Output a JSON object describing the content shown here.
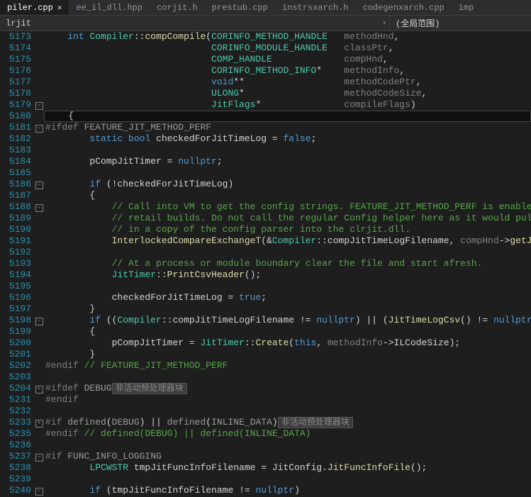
{
  "tabs": [
    {
      "label": "piler.cpp",
      "active": true,
      "close": "✕"
    },
    {
      "label": "ee_il_dll.hpp"
    },
    {
      "label": "corjit.h"
    },
    {
      "label": "prestub.cpp"
    },
    {
      "label": "instrsxarch.h"
    },
    {
      "label": "codegenxarch.cpp"
    },
    {
      "label": "imp"
    }
  ],
  "nav": {
    "scope_left": "lrjit",
    "scope_right": "(全局范围)",
    "arrow": "▾"
  },
  "gutter_start": 5173,
  "lines": [
    {
      "n": "5173",
      "ind": "    ",
      "tokens": [
        [
          "kw",
          "int"
        ],
        [
          "punct",
          " "
        ],
        [
          "type",
          "Compiler"
        ],
        [
          "punct",
          "::"
        ],
        [
          "func",
          "compCompile"
        ],
        [
          "punct",
          "("
        ],
        [
          "type",
          "CORINFO_METHOD_HANDLE"
        ],
        [
          "punct",
          "   "
        ],
        [
          "param",
          "methodHnd"
        ],
        [
          "punct",
          ","
        ]
      ]
    },
    {
      "n": "5174",
      "ind": "                              ",
      "tokens": [
        [
          "type",
          "CORINFO_MODULE_HANDLE"
        ],
        [
          "punct",
          "   "
        ],
        [
          "param",
          "classPtr"
        ],
        [
          "punct",
          ","
        ]
      ]
    },
    {
      "n": "5175",
      "ind": "                              ",
      "tokens": [
        [
          "type",
          "COMP_HANDLE"
        ],
        [
          "punct",
          "             "
        ],
        [
          "param",
          "compHnd"
        ],
        [
          "punct",
          ","
        ]
      ]
    },
    {
      "n": "5176",
      "ind": "                              ",
      "tokens": [
        [
          "type",
          "CORINFO_METHOD_INFO"
        ],
        [
          "punct",
          "*    "
        ],
        [
          "param",
          "methodInfo"
        ],
        [
          "punct",
          ","
        ]
      ]
    },
    {
      "n": "5177",
      "ind": "                              ",
      "tokens": [
        [
          "kw",
          "void"
        ],
        [
          "punct",
          "**                  "
        ],
        [
          "param",
          "methodCodePtr"
        ],
        [
          "punct",
          ","
        ]
      ]
    },
    {
      "n": "5178",
      "ind": "                              ",
      "tokens": [
        [
          "type",
          "ULONG"
        ],
        [
          "punct",
          "*                  "
        ],
        [
          "param",
          "methodCodeSize"
        ],
        [
          "punct",
          ","
        ]
      ]
    },
    {
      "n": "5179",
      "ind": "                              ",
      "fold": "-",
      "tokens": [
        [
          "type",
          "JitFlags"
        ],
        [
          "punct",
          "*               "
        ],
        [
          "param",
          "compileFlags"
        ],
        [
          "punct",
          ")"
        ]
      ]
    },
    {
      "n": "5180",
      "ind": "    ",
      "hl": true,
      "tokens": [
        [
          "punct",
          "{"
        ]
      ]
    },
    {
      "n": "5181",
      "ind": "",
      "fold": "-",
      "tokens": [
        [
          "macro-kw",
          "#ifdef"
        ],
        [
          "punct",
          " "
        ],
        [
          "macro",
          "FEATURE_JIT_METHOD_PERF"
        ]
      ]
    },
    {
      "n": "5182",
      "ind": "        ",
      "tokens": [
        [
          "kw",
          "static"
        ],
        [
          "punct",
          " "
        ],
        [
          "kw",
          "bool"
        ],
        [
          "punct",
          " checkedForJitTimeLog = "
        ],
        [
          "kw",
          "false"
        ],
        [
          "punct",
          ";"
        ]
      ]
    },
    {
      "n": "5183",
      "ind": "",
      "tokens": []
    },
    {
      "n": "5184",
      "ind": "        ",
      "tokens": [
        [
          "punct",
          "pCompJitTimer = "
        ],
        [
          "kw",
          "nullptr"
        ],
        [
          "punct",
          ";"
        ]
      ]
    },
    {
      "n": "5185",
      "ind": "",
      "tokens": []
    },
    {
      "n": "5186",
      "ind": "        ",
      "fold": "-",
      "tokens": [
        [
          "kw",
          "if"
        ],
        [
          "punct",
          " (!checkedForJitTimeLog)"
        ]
      ]
    },
    {
      "n": "5187",
      "ind": "        ",
      "tokens": [
        [
          "punct",
          "{"
        ]
      ]
    },
    {
      "n": "5188",
      "ind": "            ",
      "fold": "-",
      "tokens": [
        [
          "comment",
          "// Call into VM to get the config strings. FEATURE_JIT_METHOD_PERF is enabled for"
        ]
      ]
    },
    {
      "n": "5189",
      "ind": "            ",
      "tokens": [
        [
          "comment",
          "// retail builds. Do not call the regular Config helper here as it would pull"
        ]
      ]
    },
    {
      "n": "5190",
      "ind": "            ",
      "tokens": [
        [
          "comment",
          "// in a copy of the config parser into the clrjit.dll."
        ]
      ]
    },
    {
      "n": "5191",
      "ind": "            ",
      "tokens": [
        [
          "func",
          "InterlockedCompareExchangeT"
        ],
        [
          "punct",
          "(&"
        ],
        [
          "type",
          "Compiler"
        ],
        [
          "punct",
          "::compJitTimeLogFilename, "
        ],
        [
          "param",
          "compHnd"
        ],
        [
          "punct",
          "->"
        ],
        [
          "func",
          "getJitTimeLogFilen"
        ]
      ]
    },
    {
      "n": "5192",
      "ind": "",
      "tokens": []
    },
    {
      "n": "5193",
      "ind": "            ",
      "tokens": [
        [
          "comment",
          "// At a process or module boundary clear the file and start afresh."
        ]
      ]
    },
    {
      "n": "5194",
      "ind": "            ",
      "tokens": [
        [
          "type",
          "JitTimer"
        ],
        [
          "punct",
          "::"
        ],
        [
          "func",
          "PrintCsvHeader"
        ],
        [
          "punct",
          "();"
        ]
      ]
    },
    {
      "n": "5195",
      "ind": "",
      "tokens": []
    },
    {
      "n": "5196",
      "ind": "            ",
      "tokens": [
        [
          "punct",
          "checkedForJitTimeLog = "
        ],
        [
          "kw",
          "true"
        ],
        [
          "punct",
          ";"
        ]
      ]
    },
    {
      "n": "5197",
      "ind": "        ",
      "tokens": [
        [
          "punct",
          "}"
        ]
      ]
    },
    {
      "n": "5198",
      "ind": "        ",
      "fold": "-",
      "tokens": [
        [
          "kw",
          "if"
        ],
        [
          "punct",
          " (("
        ],
        [
          "type",
          "Compiler"
        ],
        [
          "punct",
          "::compJitTimeLogFilename != "
        ],
        [
          "kw",
          "nullptr"
        ],
        [
          "punct",
          ") || ("
        ],
        [
          "func",
          "JitTimeLogCsv"
        ],
        [
          "punct",
          "() != "
        ],
        [
          "kw",
          "nullptr"
        ],
        [
          "punct",
          "))"
        ]
      ]
    },
    {
      "n": "5199",
      "ind": "        ",
      "tokens": [
        [
          "punct",
          "{"
        ]
      ]
    },
    {
      "n": "5200",
      "ind": "            ",
      "tokens": [
        [
          "punct",
          "pCompJitTimer = "
        ],
        [
          "type",
          "JitTimer"
        ],
        [
          "punct",
          "::"
        ],
        [
          "func",
          "Create"
        ],
        [
          "punct",
          "("
        ],
        [
          "kw",
          "this"
        ],
        [
          "punct",
          ", "
        ],
        [
          "param",
          "methodInfo"
        ],
        [
          "punct",
          "->ILCodeSize);"
        ]
      ]
    },
    {
      "n": "5201",
      "ind": "        ",
      "tokens": [
        [
          "punct",
          "}"
        ]
      ]
    },
    {
      "n": "5202",
      "ind": "",
      "tokens": [
        [
          "macro-kw",
          "#endif"
        ],
        [
          "punct",
          " "
        ],
        [
          "comment",
          "// FEATURE_JIT_METHOD_PERF"
        ]
      ]
    },
    {
      "n": "5203",
      "ind": "",
      "tokens": []
    },
    {
      "n": "5204",
      "ind": "",
      "fold": "+",
      "tokens": [
        [
          "macro-kw",
          "#ifdef"
        ],
        [
          "punct",
          " "
        ],
        [
          "macro",
          "DEBUG"
        ]
      ],
      "badge": "非活动预处理器块"
    },
    {
      "n": "5231",
      "ind": "",
      "tokens": [
        [
          "macro-kw",
          "#endif"
        ]
      ]
    },
    {
      "n": "5232",
      "ind": "",
      "tokens": []
    },
    {
      "n": "5233",
      "ind": "",
      "fold": "+",
      "tokens": [
        [
          "macro-kw",
          "#if"
        ],
        [
          "punct",
          " "
        ],
        [
          "macro",
          "defined"
        ],
        [
          "punct",
          "("
        ],
        [
          "macro",
          "DEBUG"
        ],
        [
          "punct",
          ") || "
        ],
        [
          "macro",
          "defined"
        ],
        [
          "punct",
          "("
        ],
        [
          "macro",
          "INLINE_DATA"
        ],
        [
          "punct",
          ")"
        ]
      ],
      "badge": "非活动预处理器块"
    },
    {
      "n": "5235",
      "ind": "",
      "tokens": [
        [
          "macro-kw",
          "#endif"
        ],
        [
          "punct",
          " "
        ],
        [
          "comment",
          "// defined(DEBUG) || defined(INLINE_DATA)"
        ]
      ]
    },
    {
      "n": "5236",
      "ind": "",
      "tokens": []
    },
    {
      "n": "5237",
      "ind": "",
      "fold": "-",
      "tokens": [
        [
          "macro-kw",
          "#if"
        ],
        [
          "punct",
          " "
        ],
        [
          "macro",
          "FUNC_INFO_LOGGING"
        ]
      ]
    },
    {
      "n": "5238",
      "ind": "        ",
      "tokens": [
        [
          "type",
          "LPCWSTR"
        ],
        [
          "punct",
          " tmpJitFuncInfoFilename = JitConfig."
        ],
        [
          "func",
          "JitFuncInfoFile"
        ],
        [
          "punct",
          "();"
        ]
      ]
    },
    {
      "n": "5239",
      "ind": "",
      "tokens": []
    },
    {
      "n": "5240",
      "ind": "        ",
      "fold": "-",
      "tokens": [
        [
          "kw",
          "if"
        ],
        [
          "punct",
          " (tmpJitFuncInfoFilename != "
        ],
        [
          "kw",
          "nullptr"
        ],
        [
          "punct",
          ")"
        ]
      ]
    }
  ]
}
